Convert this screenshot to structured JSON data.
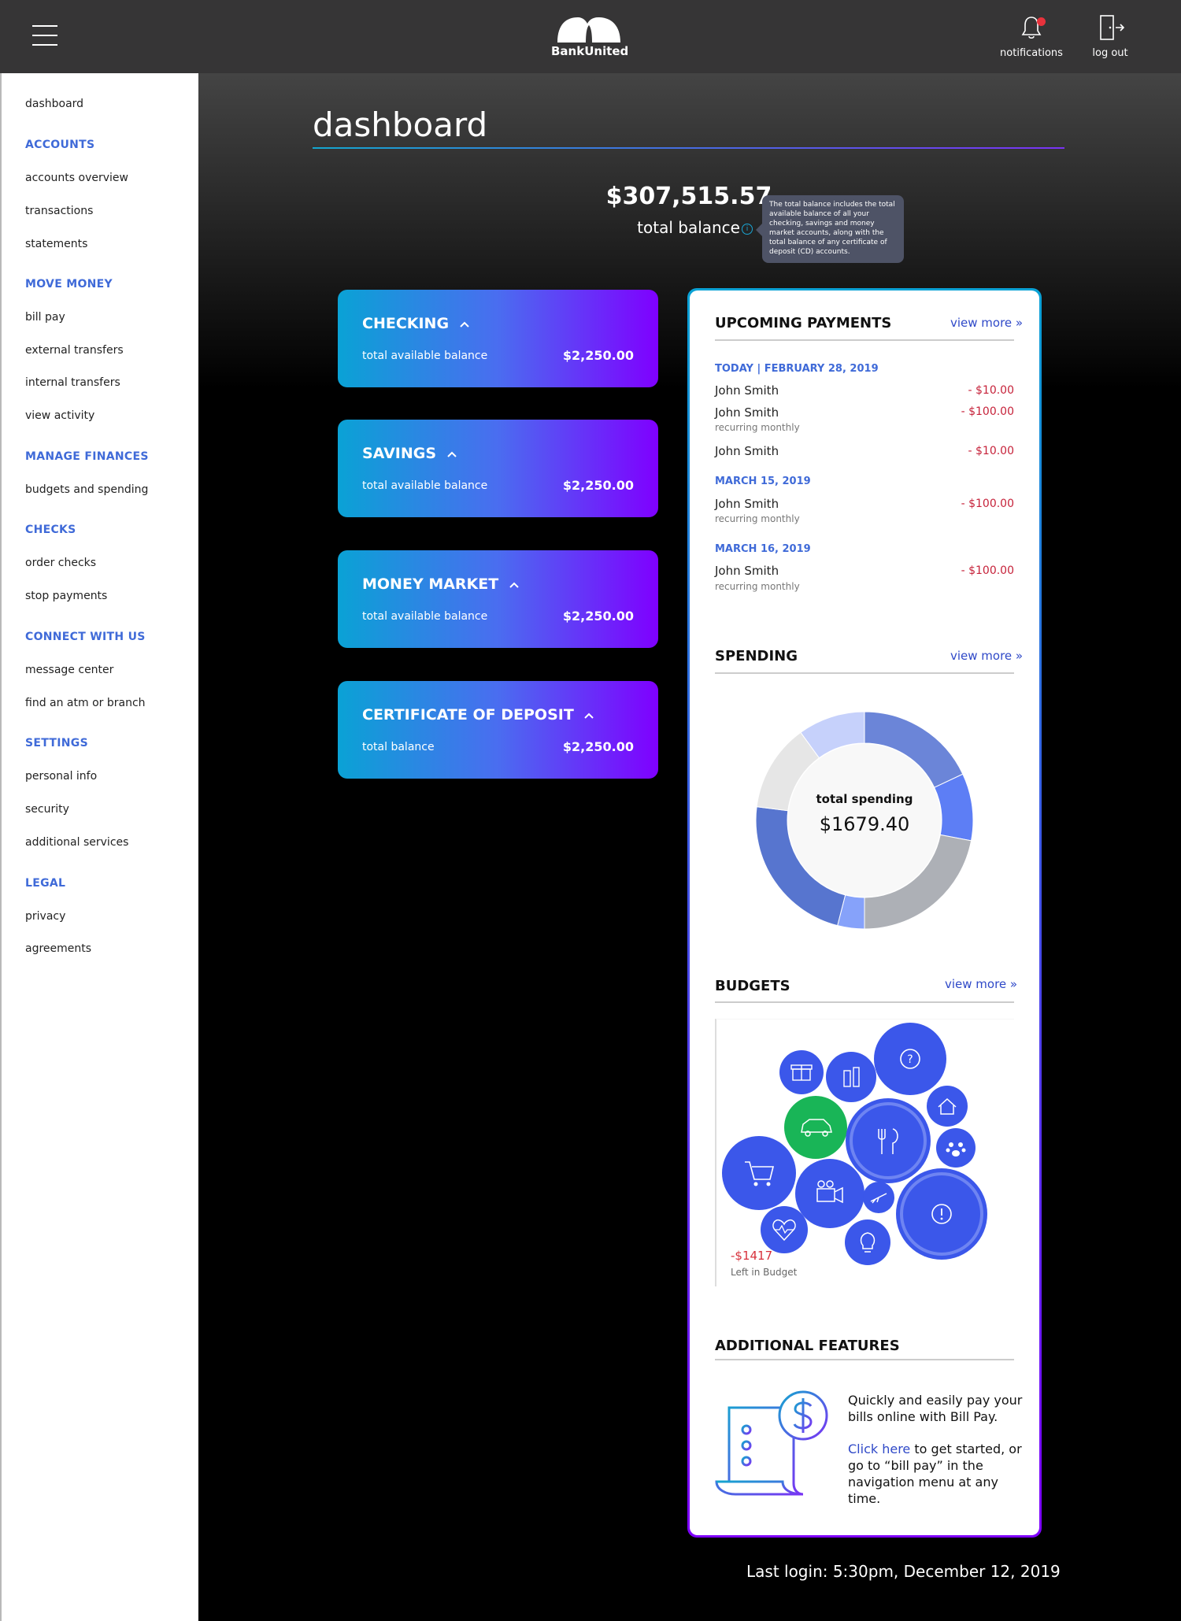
{
  "header": {
    "brand": "BankUnited",
    "notifications_label": "notifications",
    "logout_label": "log out"
  },
  "sidebar": {
    "top_item": "dashboard",
    "sections": [
      {
        "heading": "ACCOUNTS",
        "items": [
          "accounts overview",
          "transactions",
          "statements"
        ]
      },
      {
        "heading": "MOVE MONEY",
        "items": [
          "bill pay",
          "external transfers",
          "internal transfers",
          "view activity"
        ]
      },
      {
        "heading": "MANAGE FINANCES",
        "items": [
          "budgets and spending"
        ]
      },
      {
        "heading": "CHECKS",
        "items": [
          "order checks",
          "stop payments"
        ]
      },
      {
        "heading": "CONNECT WITH US",
        "items": [
          "message center",
          "find an atm or branch"
        ]
      },
      {
        "heading": "SETTINGS",
        "items": [
          "personal info",
          "security",
          "additional services"
        ]
      },
      {
        "heading": "LEGAL",
        "items": [
          "privacy",
          "agreements"
        ]
      }
    ]
  },
  "main": {
    "title": "dashboard",
    "total_balance": "$307,515.57",
    "total_balance_label": "total balance",
    "info_glyph": "i",
    "tooltip": "The total balance includes the total available balance of all your checking, savings and money market accounts, along with the total balance of any certificate of deposit (CD) accounts.",
    "accounts": [
      {
        "name": "CHECKING",
        "sub": "total available balance",
        "amount": "$2,250.00"
      },
      {
        "name": "SAVINGS",
        "sub": "total available balance",
        "amount": "$2,250.00"
      },
      {
        "name": "MONEY MARKET",
        "sub": "total available balance",
        "amount": "$2,250.00"
      },
      {
        "name": "CERTIFICATE OF DEPOSIT",
        "sub": "total balance",
        "amount": "$2,250.00"
      }
    ],
    "last_login": "Last login: 5:30pm, December 12, 2019"
  },
  "upcoming": {
    "title": "UPCOMING PAYMENTS",
    "view_more": "view more »",
    "groups": [
      {
        "date": "TODAY  |  FEBRUARY 28, 2019",
        "payments": [
          {
            "name": "John Smith",
            "amount": "- $10.00",
            "note": ""
          },
          {
            "name": "John Smith",
            "amount": "- $100.00",
            "note": "recurring monthly"
          },
          {
            "name": "John Smith",
            "amount": "- $10.00",
            "note": ""
          }
        ]
      },
      {
        "date": "MARCH 15, 2019",
        "payments": [
          {
            "name": "John Smith",
            "amount": "- $100.00",
            "note": "recurring monthly"
          }
        ]
      },
      {
        "date": "MARCH 16, 2019",
        "payments": [
          {
            "name": "John Smith",
            "amount": "- $100.00",
            "note": "recurring monthly"
          }
        ]
      }
    ]
  },
  "spending": {
    "title": "SPENDING",
    "view_more": "view more »",
    "center_label": "total spending",
    "center_amount": "$1679.40"
  },
  "chart_data": {
    "type": "pie",
    "values": [
      18,
      10,
      22,
      4,
      23,
      13,
      10
    ],
    "colors": [
      "#6b85d8",
      "#5d7ef5",
      "#adb0b6",
      "#86a2fa",
      "#5775cf",
      "#e6e6e6",
      "#c6d1fb"
    ]
  },
  "budgets": {
    "title": "BUDGETS",
    "view_more": "view more »",
    "left_amount": "-$1417",
    "left_label": "Left in Budget",
    "bubble_icons": [
      "help-icon",
      "gift-icon",
      "toiletries-icon",
      "home-icon",
      "car-icon",
      "dining-icon",
      "pet-icon",
      "shopping-cart-icon",
      "video-camera-icon",
      "travel-icon",
      "alert-icon",
      "health-icon",
      "utilities-icon"
    ]
  },
  "features": {
    "title": "ADDITIONAL FEATURES",
    "line1": "Quickly and easily pay your bills online with Bill Pay.",
    "link": "Click here",
    "line2": " to get started, or go to “bill pay” in the navigation menu at any time."
  },
  "colors": {
    "accent_blue": "#3f6ad8",
    "card_start": "#0aa2d5",
    "card_end": "#7f00ff",
    "negative": "#c6223a"
  }
}
